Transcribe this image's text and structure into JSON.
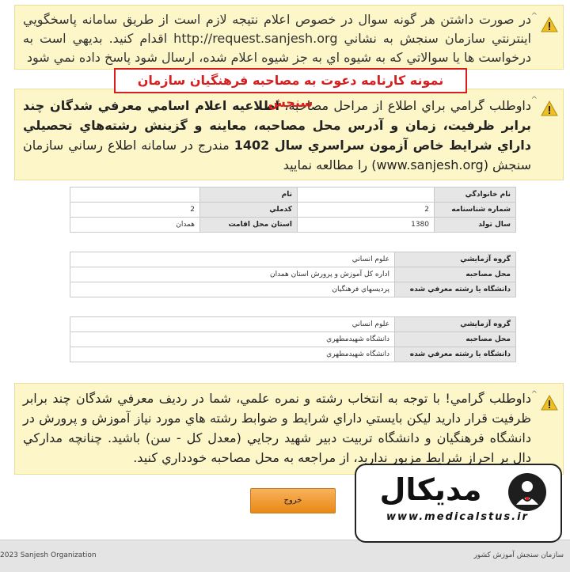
{
  "notices": {
    "n1": {
      "text": "در صورت داشتن هر گونه سوال در خصوص اعلام نتيجه لازم است از طريق سامانه پاسخگويي اينترنتي سازمان سنجش به نشاني http://request.sanjesh.org اقدام کنيد. بديهي است به درخواست ها يا سوالاتي که به شيوه اي به جز شيوه اعلام شده، ارسال شود پاسخ داده نمي شود"
    },
    "n2": {
      "part1": "داوطلب گرامي براي اطلاع از مراحل مصاحبه، ",
      "bold": "اطلاعيه اعلام اسامي معرفي شدگان چند برابر ظرفيت، زمان و آدرس محل مصاحبه، معاينه و گزينش رشته‌هاي تحصيلي داراي شرايط خاص آزمون سراسري سال 1402",
      "part2": " مندرج در سامانه اطلاع رساني سازمان سنجش (www.sanjesh.org) را مطالعه نماييد"
    },
    "n3": {
      "text": "داوطلب گرامي! با توجه به انتخاب رشته و نمره علمي، شما در رديف معرفي شدگان چند برابر ظرفيت قرار داريد ليکن بايستي داراي شرايط و ضوابط رشته هاي مورد نياز آموزش و پرورش در دانشگاه فرهنگيان و دانشگاه تربيت دبير شهيد رجايي (معدل کل - سن) باشيد. چنانچه مدارکي دال بر احراز شرايط مزبور نداريد، از مراجعه به محل مصاحبه خودداري کنيد."
    }
  },
  "red_title": "نمونه کارنامه دعوت به مصاحبه فرهنگيان سازمان سنجش",
  "personal": {
    "family_label": "نام خانوادگي",
    "family_value": "",
    "name_label": "نام",
    "name_value": "",
    "id_label": "شماره شناسنامه",
    "id_value": "2",
    "code_label": "کدملي",
    "code_value": "2",
    "birth_label": "سال تولد",
    "birth_value": "1380",
    "province_label": "استان محل اقامت",
    "province_value": "همدان"
  },
  "group1": {
    "group_label": "گروه آزمايشي",
    "group_value": "علوم انساني",
    "place_label": "محل مصاحبه",
    "place_value": "اداره کل آموزش و پرورش استان همدان",
    "uni_label": "دانشگاه يا رشته معرفي شده",
    "uni_value": "پرديسهاي فرهنگيان"
  },
  "group2": {
    "group_label": "گروه آزمايشي",
    "group_value": "علوم انساني",
    "place_label": "محل مصاحبه",
    "place_value": "دانشگاه شهيدمطهري",
    "uni_label": "دانشگاه يا رشته معرفي شده",
    "uni_value": "دانشگاه شهيدمطهري"
  },
  "buttons": {
    "exit_label": "خروج"
  },
  "footer": {
    "left": "2023 Sanjesh Organization",
    "right": "سازمان سنجش آموزش کشور"
  },
  "watermark": {
    "brand": "مديکال",
    "url": "www.medicalstus.ir"
  },
  "colors": {
    "notice_bg": "#fdf6c9",
    "title_red": "#d81e1e",
    "button_orange": "#f0a040",
    "warning_icon": "#f0c020"
  }
}
